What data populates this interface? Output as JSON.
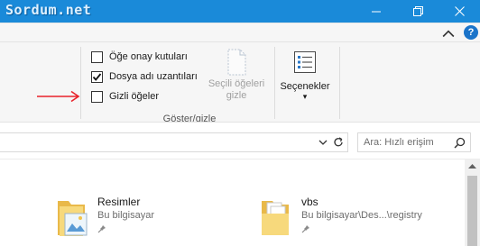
{
  "window": {
    "watermark": "Sordum.net",
    "controls": [
      "minimize-icon",
      "maximize-icon",
      "close-icon"
    ]
  },
  "ribbon": {
    "help_label": "?",
    "checkboxes": [
      {
        "label": "Öğe onay kutuları",
        "checked": false
      },
      {
        "label": "Dosya adı uzantıları",
        "checked": true
      },
      {
        "label": "Gizli öğeler",
        "checked": false
      }
    ],
    "hide_selected": {
      "line1": "Seçili öğeleri",
      "line2": "gizle",
      "enabled": false
    },
    "group_label": "Göster/gizle",
    "options": {
      "label": "Seçenekler",
      "arrow": "▾"
    },
    "annotation_arrow_color": "#e8222a"
  },
  "address_bar": {
    "value": "",
    "search_placeholder": "Ara: Hızlı erişim"
  },
  "content": {
    "items": [
      {
        "name": "Resimler",
        "location": "Bu bilgisayar",
        "pinned": true
      },
      {
        "name": "vbs",
        "location": "Bu bilgisayar\\Des...\\registry",
        "pinned": true
      }
    ]
  },
  "colors": {
    "title_bar": "#1a8ad9",
    "ribbon_bg": "#f6f6f6",
    "folder": "#f2c55c",
    "accent": "#1a73c9"
  }
}
